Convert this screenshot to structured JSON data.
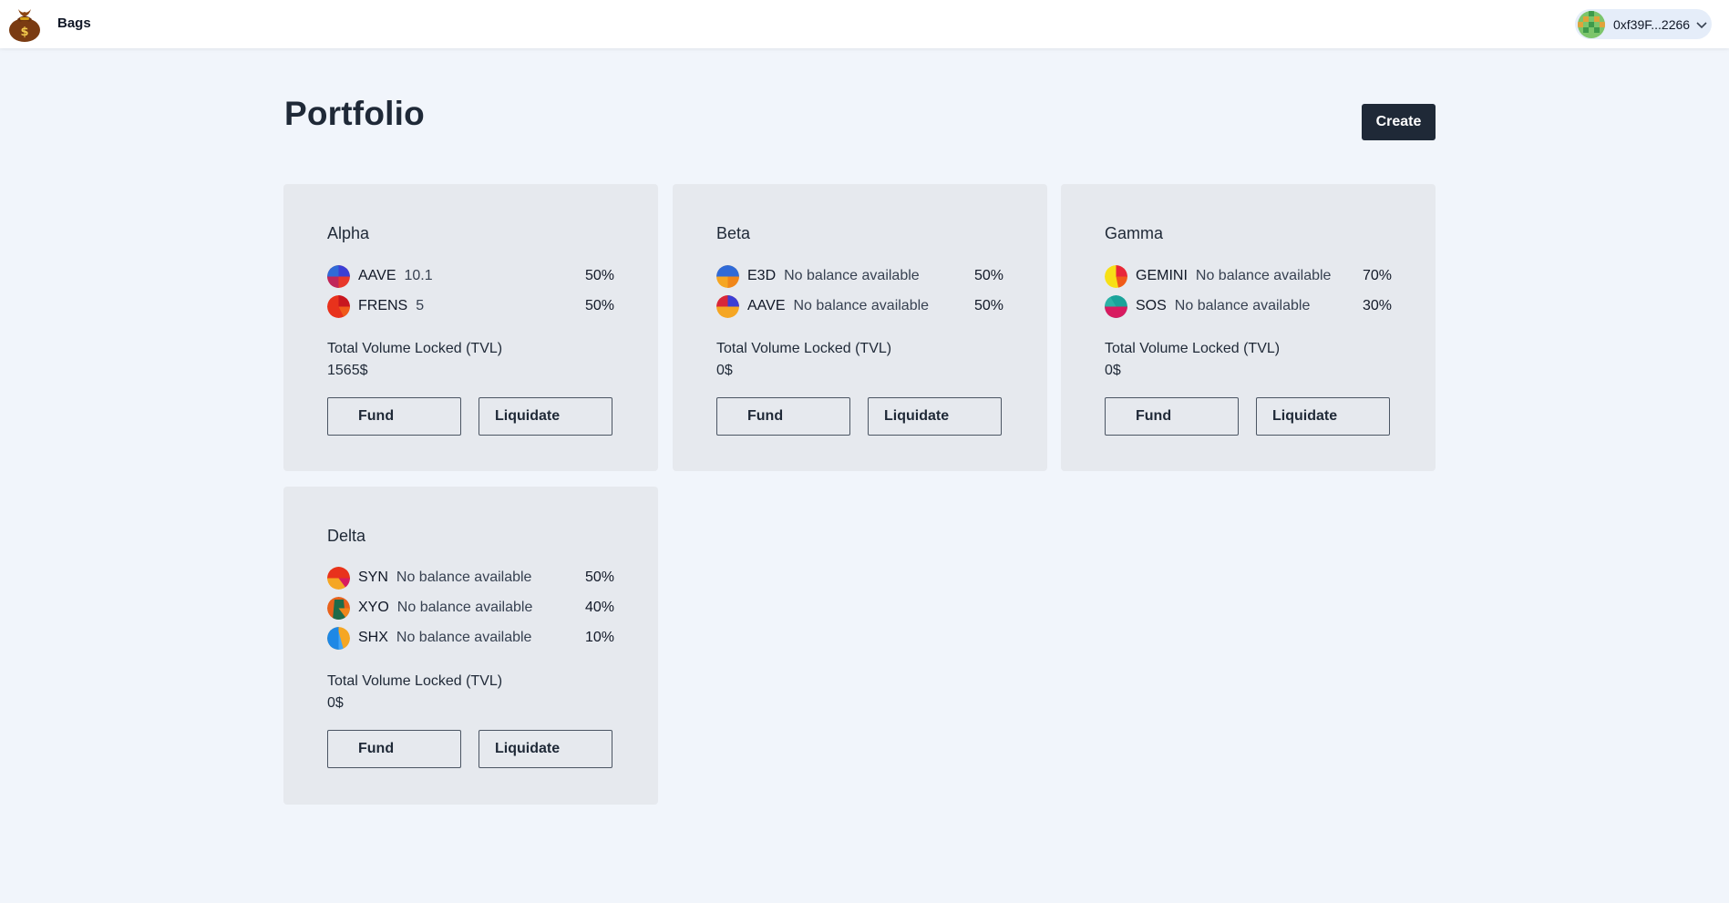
{
  "app": {
    "brand": "Bags",
    "wallet_address": "0xf39F...2266"
  },
  "page": {
    "title": "Portfolio",
    "create_label": "Create"
  },
  "labels": {
    "tvl": "Total Volume Locked (TVL)",
    "fund": "Fund",
    "liquidate": "Liquidate"
  },
  "portfolios": [
    {
      "name": "Alpha",
      "assets": [
        {
          "symbol": "AAVE",
          "balance": "10.1",
          "pct": "50%",
          "icon": "aave-token-icon"
        },
        {
          "symbol": "FRENS",
          "balance": "5",
          "pct": "50%",
          "icon": "frens-token-icon"
        }
      ],
      "tvl": "1565$"
    },
    {
      "name": "Beta",
      "assets": [
        {
          "symbol": "E3D",
          "balance": "No balance available",
          "pct": "50%",
          "icon": "e3d-token-icon"
        },
        {
          "symbol": "AAVE",
          "balance": "No balance available",
          "pct": "50%",
          "icon": "aave-token-icon"
        }
      ],
      "tvl": "0$"
    },
    {
      "name": "Gamma",
      "assets": [
        {
          "symbol": "GEMINI",
          "balance": "No balance available",
          "pct": "70%",
          "icon": "gemini-token-icon"
        },
        {
          "symbol": "SOS",
          "balance": "No balance available",
          "pct": "30%",
          "icon": "sos-token-icon"
        }
      ],
      "tvl": "0$"
    },
    {
      "name": "Delta",
      "assets": [
        {
          "symbol": "SYN",
          "balance": "No balance available",
          "pct": "50%",
          "icon": "syn-token-icon"
        },
        {
          "symbol": "XYO",
          "balance": "No balance available",
          "pct": "40%",
          "icon": "xyo-token-icon"
        },
        {
          "symbol": "SHX",
          "balance": "No balance available",
          "pct": "10%",
          "icon": "shx-token-icon"
        }
      ],
      "tvl": "0$"
    }
  ],
  "colors": {
    "background": "#f1f5fb",
    "card": "#e6e9ee",
    "primary_button": "#1f2937",
    "wallet_pill": "#e5edf9"
  }
}
